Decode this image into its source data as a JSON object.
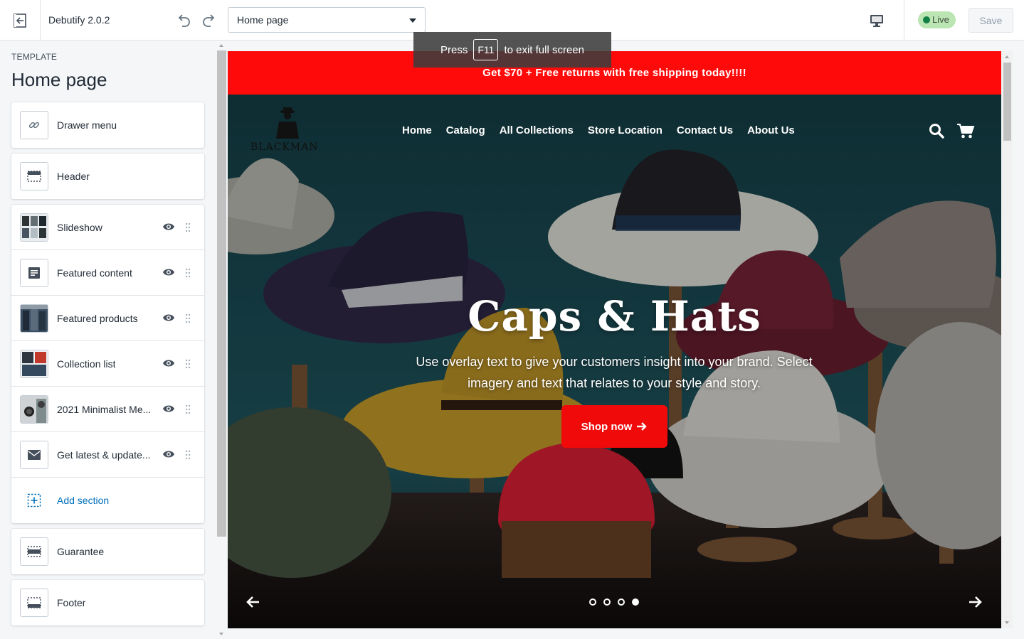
{
  "topbar": {
    "theme_name": "Debutify 2.0.2",
    "page_select_value": "Home page",
    "live_label": "Live",
    "save_label": "Save",
    "icons": [
      "exit-icon",
      "undo-icon",
      "redo-icon",
      "desktop-icon"
    ]
  },
  "fullscreen_toast": {
    "prefix": "Press",
    "key": "F11",
    "suffix": "to exit full screen"
  },
  "sidebar": {
    "template_label": "TEMPLATE",
    "title": "Home page",
    "fixed_top": [
      {
        "label": "Drawer menu",
        "icon": "link-icon"
      },
      {
        "label": "Header",
        "icon": "header-layout-icon"
      }
    ],
    "sections": [
      {
        "label": "Slideshow",
        "icon": "slideshow-thumb"
      },
      {
        "label": "Featured content",
        "icon": "text-block-icon"
      },
      {
        "label": "Featured products",
        "icon": "products-thumb"
      },
      {
        "label": "Collection list",
        "icon": "collection-thumb"
      },
      {
        "label": "2021 Minimalist Me...",
        "icon": "watch-thumb"
      },
      {
        "label": "Get latest & update...",
        "icon": "envelope-icon"
      }
    ],
    "add_section_label": "Add section",
    "fixed_bottom": [
      {
        "label": "Guarantee",
        "icon": "guarantee-layout-icon"
      },
      {
        "label": "Footer",
        "icon": "footer-layout-icon"
      }
    ]
  },
  "preview": {
    "announcement": "Get $70 + Free returns with free shipping today!!!!",
    "logo_text": "BLACKMAN",
    "nav": [
      "Home",
      "Catalog",
      "All Collections",
      "Store Location",
      "Contact Us",
      "About Us"
    ],
    "hero_title": "Caps & Hats",
    "hero_subtitle": "Use overlay text to give your customers insight into your brand. Select imagery and text that relates to your style and story.",
    "cta_label": "Shop now",
    "slides_total": 4,
    "slide_active": 4,
    "colors": {
      "announcement_bg": "#ff0a0a",
      "cta_bg": "#f00a0a",
      "hero_bg": "#1b4a52"
    }
  }
}
